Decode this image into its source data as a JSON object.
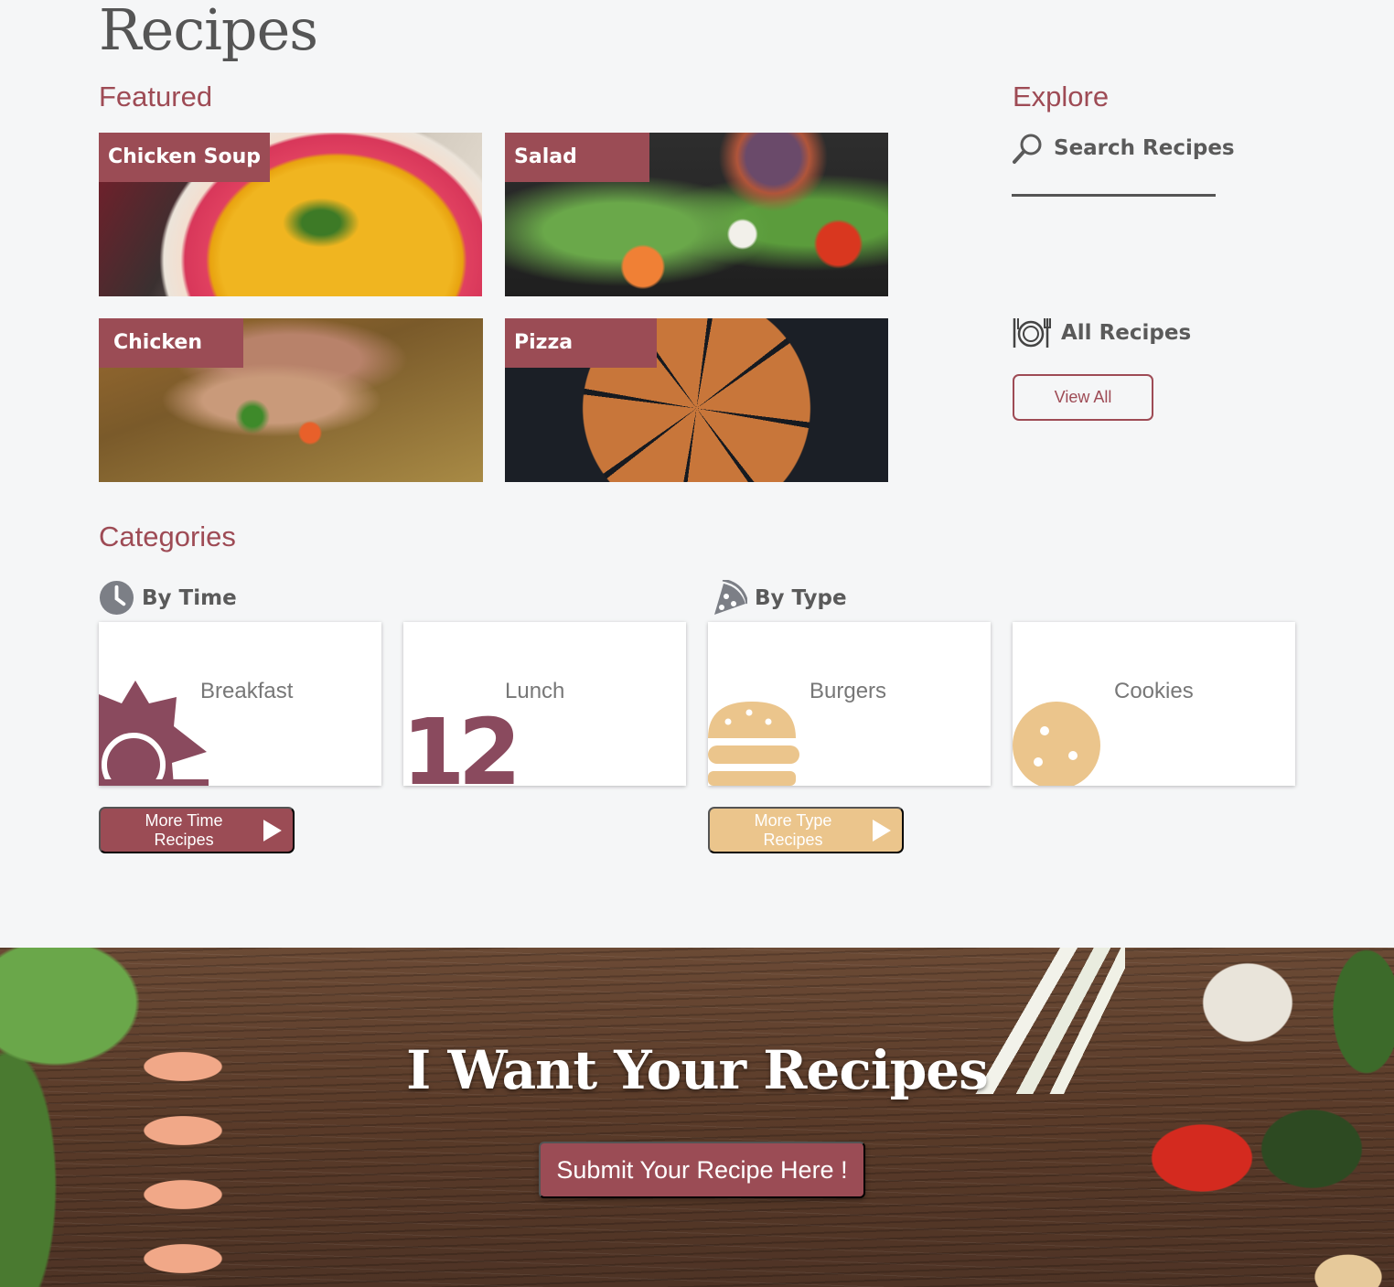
{
  "page": {
    "title": "Recipes"
  },
  "featured": {
    "heading": "Featured",
    "cards": [
      {
        "label": "Chicken Soup"
      },
      {
        "label": "Salad"
      },
      {
        "label": "Chicken"
      },
      {
        "label": "Pizza"
      }
    ]
  },
  "explore": {
    "heading": "Explore",
    "search_label": "Search Recipes",
    "all_recipes_label": "All Recipes",
    "view_all_button": "View All"
  },
  "categories": {
    "heading": "Categories",
    "by_time": {
      "label": "By Time",
      "items": [
        {
          "label": "Breakfast",
          "icon": "sun-icon"
        },
        {
          "label": "Lunch",
          "icon_text": "12"
        }
      ],
      "more_button": "More Time Recipes"
    },
    "by_type": {
      "label": "By Type",
      "items": [
        {
          "label": "Burgers",
          "icon": "burger-icon"
        },
        {
          "label": "Cookies",
          "icon": "cookie-icon"
        }
      ],
      "more_button": "More Type Recipes"
    }
  },
  "banner": {
    "title": "I Want Your Recipes",
    "submit_button": "Submit Your Recipe Here !"
  },
  "colors": {
    "accent": "#9b4c55",
    "heading": "#9e4b55",
    "time_icon": "#8a4a5e",
    "type_icon": "#ebc58c"
  }
}
